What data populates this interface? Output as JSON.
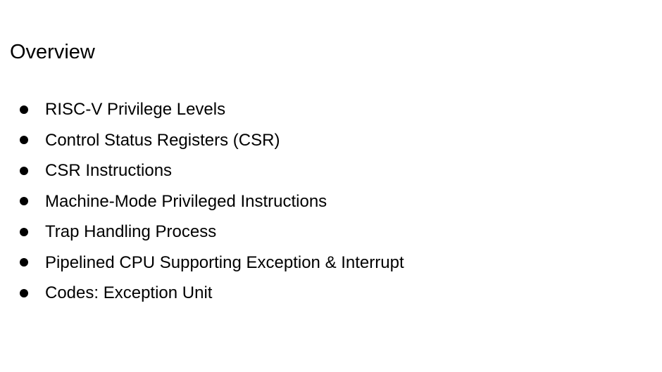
{
  "slide": {
    "title": "Overview",
    "bullets": [
      "RISC-V Privilege Levels",
      "Control Status Registers (CSR)",
      "CSR Instructions",
      "Machine-Mode Privileged Instructions",
      "Trap Handling Process",
      "Pipelined CPU Supporting Exception & Interrupt",
      "Codes: Exception Unit"
    ]
  }
}
